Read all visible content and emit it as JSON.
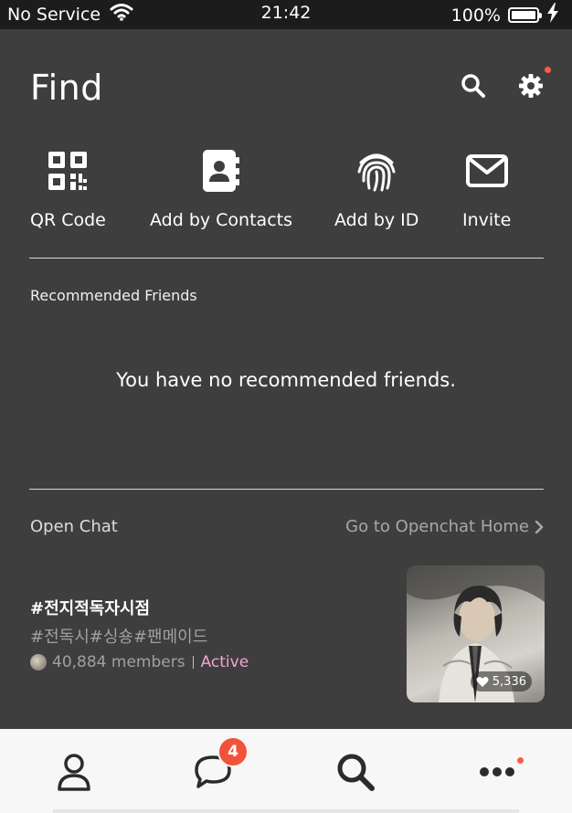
{
  "status_bar": {
    "carrier": "No Service",
    "time": "21:42",
    "battery": "100%"
  },
  "header": {
    "title": "Find"
  },
  "actions": [
    {
      "label": "QR Code",
      "icon": "qr-code-icon"
    },
    {
      "label": "Add by Contacts",
      "icon": "contacts-book-icon"
    },
    {
      "label": "Add by ID",
      "icon": "fingerprint-icon"
    },
    {
      "label": "Invite",
      "icon": "envelope-icon"
    }
  ],
  "recommended": {
    "title": "Recommended Friends",
    "empty_message": "You have no recommended friends."
  },
  "openchat": {
    "title": "Open Chat",
    "home_link": "Go to Openchat Home",
    "item": {
      "name": "#전지적독자시점",
      "tags": "#전독시#싱숑#팬메이드",
      "members": "40,884 members",
      "status": "Active",
      "likes": "5,336"
    }
  },
  "bottom_nav": {
    "items": [
      "friends",
      "chats",
      "find",
      "more"
    ],
    "chats_badge": "4"
  },
  "colors": {
    "background": "#3e3e3e",
    "status_bar": "#1c1c1c",
    "badge": "#f0533a",
    "active": "#f5a3d6"
  }
}
